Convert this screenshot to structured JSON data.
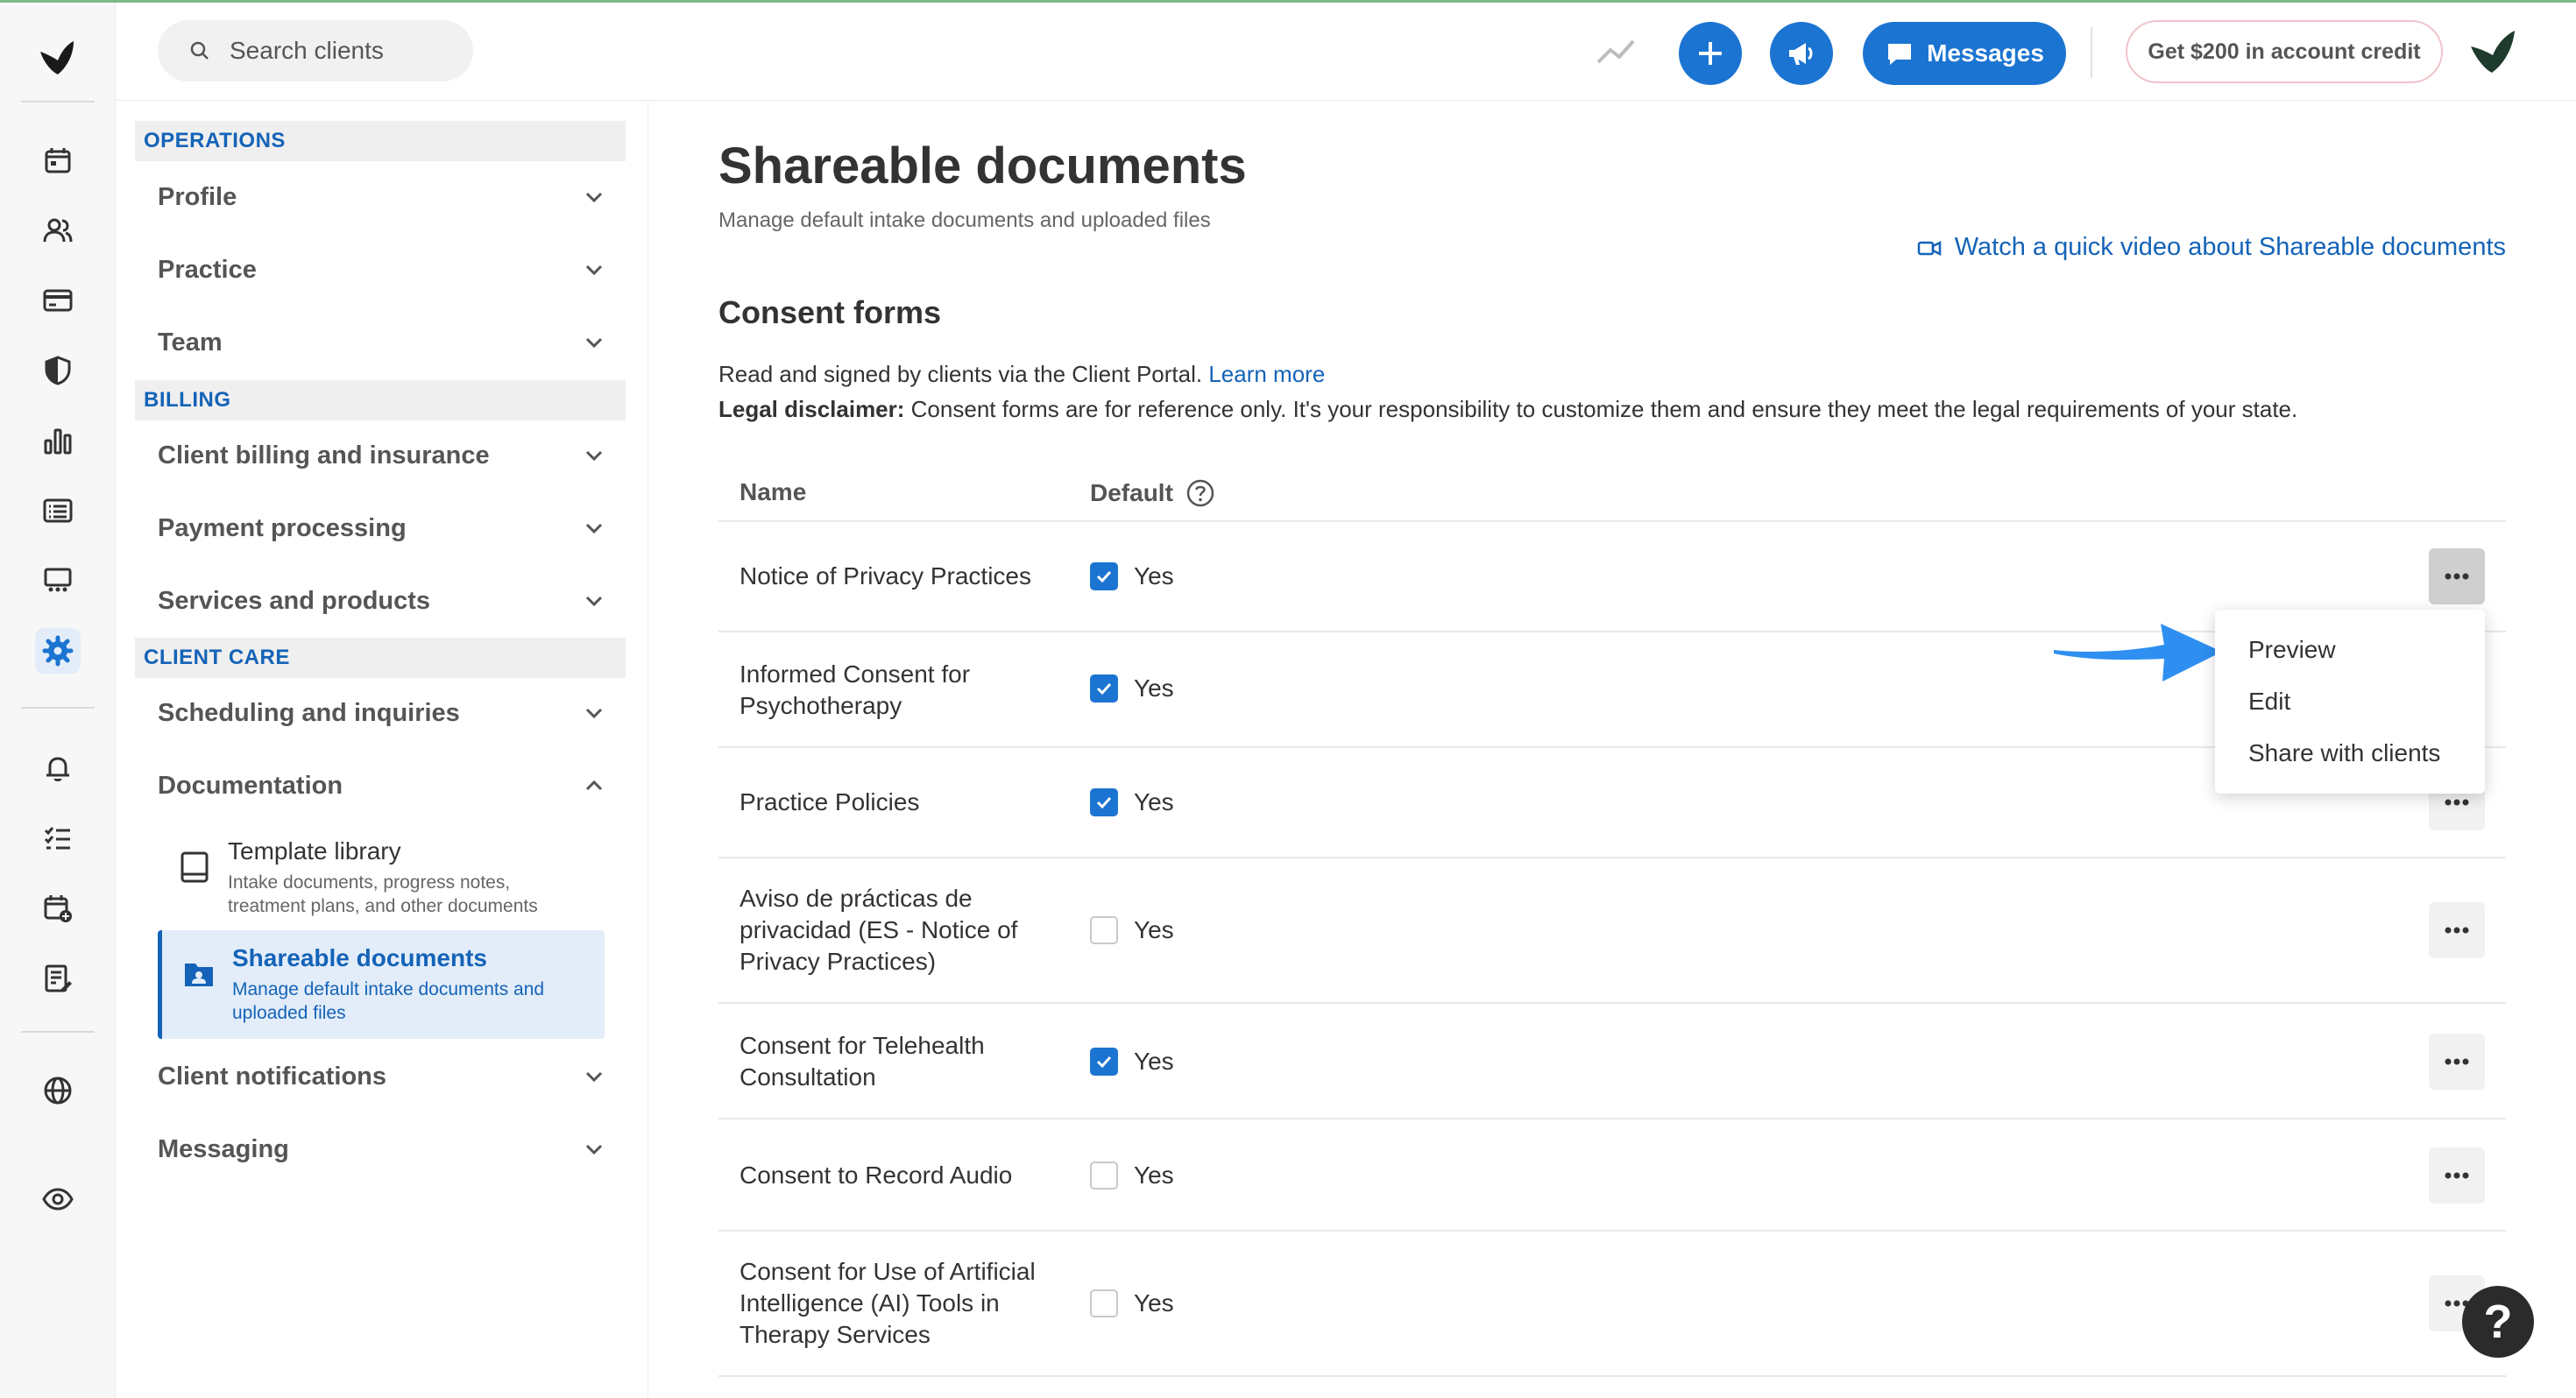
{
  "topbar": {
    "search_placeholder": "Search clients",
    "messages_label": "Messages",
    "credit_label": "Get $200 in account credit"
  },
  "nav": {
    "operations_header": "OPERATIONS",
    "profile": "Profile",
    "practice": "Practice",
    "team": "Team",
    "billing_header": "BILLING",
    "client_billing": "Client billing and insurance",
    "payment_processing": "Payment processing",
    "services_products": "Services and products",
    "client_care_header": "CLIENT CARE",
    "scheduling": "Scheduling and inquiries",
    "documentation": "Documentation",
    "template_library_title": "Template library",
    "template_library_desc": "Intake documents, progress notes, treatment plans, and other documents",
    "shareable_title": "Shareable documents",
    "shareable_desc": "Manage default intake documents and uploaded files",
    "client_notifications": "Client notifications",
    "messaging": "Messaging"
  },
  "main": {
    "title": "Shareable documents",
    "subtitle": "Manage default intake documents and uploaded files",
    "video_link": "Watch a quick video about Shareable documents",
    "section_title": "Consent forms",
    "desc_text": "Read and signed by clients via the Client Portal.",
    "learn_more": "Learn more",
    "disclaimer_label": "Legal disclaimer:",
    "disclaimer_text": "Consent forms are for reference only. It's your responsibility to customize them and ensure they meet the legal requirements of your state.",
    "col_name": "Name",
    "col_default": "Default",
    "yes_label": "Yes",
    "rows": [
      {
        "name": "Notice of Privacy Practices",
        "default": true
      },
      {
        "name": "Informed Consent for Psychotherapy",
        "default": true
      },
      {
        "name": "Practice Policies",
        "default": true
      },
      {
        "name": "Aviso de prácticas de privacidad (ES - Notice of Privacy Practices)",
        "default": false
      },
      {
        "name": "Consent for Telehealth Consultation",
        "default": true
      },
      {
        "name": "Consent to Record Audio",
        "default": false
      },
      {
        "name": "Consent for Use of Artificial Intelligence (AI) Tools in Therapy Services",
        "default": false
      }
    ]
  },
  "dropdown": {
    "preview": "Preview",
    "edit": "Edit",
    "share": "Share with clients"
  },
  "help_label": "?",
  "colors": {
    "accent": "#1b74d1",
    "link": "#1463b8",
    "arrow": "#2e8ff0"
  }
}
